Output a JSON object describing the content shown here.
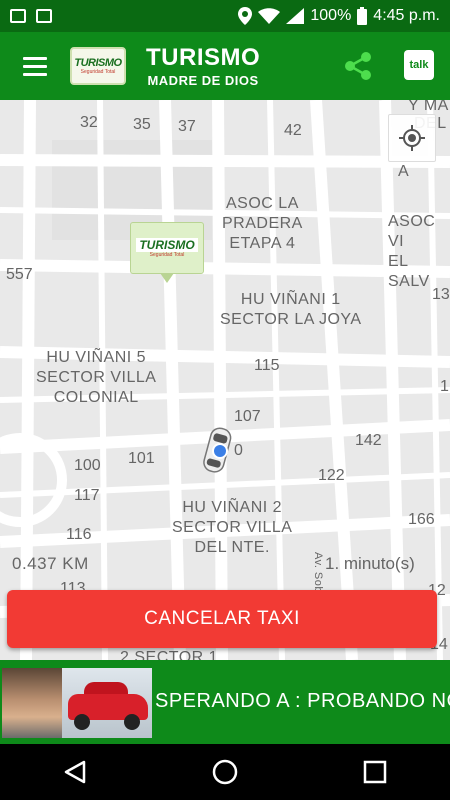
{
  "status_bar": {
    "battery_percent": "100%",
    "time": "4:45 p.m."
  },
  "app_bar": {
    "logo_text": "TURISMO",
    "logo_tagline": "Seguridad Total",
    "title": "TURISMO",
    "subtitle": "MADRE DE DIOS",
    "talk_label": "talk"
  },
  "map": {
    "labels": [
      {
        "text": "Y MA"
      },
      {
        "text": "DEL L"
      },
      {
        "text": "A"
      },
      {
        "text": "ASOC LA\nPRADERA\nETAPA 4"
      },
      {
        "text": "ASOC VI\nEL SALV"
      },
      {
        "text": "HU VIÑANI 1\nSECTOR LA JOYA"
      },
      {
        "text": "HU VIÑANI 5\nSECTOR VILLA\nCOLONIAL"
      },
      {
        "text": "HU VIÑANI 2\nSECTOR VILLA\nDEL NTE."
      },
      {
        "text": "2 SECTOR 1"
      },
      {
        "text": "Av. Sobe..."
      }
    ],
    "numbers": [
      "32",
      "35",
      "37",
      "42",
      "557",
      "13",
      "115",
      "107",
      "142",
      "100",
      "101",
      "0",
      "117",
      "122",
      "116",
      "166",
      "1",
      "12",
      "113",
      "14"
    ],
    "marker_text": "TURISMO",
    "distance": "0.437 KM",
    "duration": "1. minuto(s)"
  },
  "cancel_button_label": "CANCELAR TAXI",
  "banner": {
    "ticker": "SPERANDO A : PROBANDO NO"
  },
  "colors": {
    "primary": "#0e8a1a",
    "status_bar": "#0a6a12",
    "cancel": "#f23a34"
  }
}
